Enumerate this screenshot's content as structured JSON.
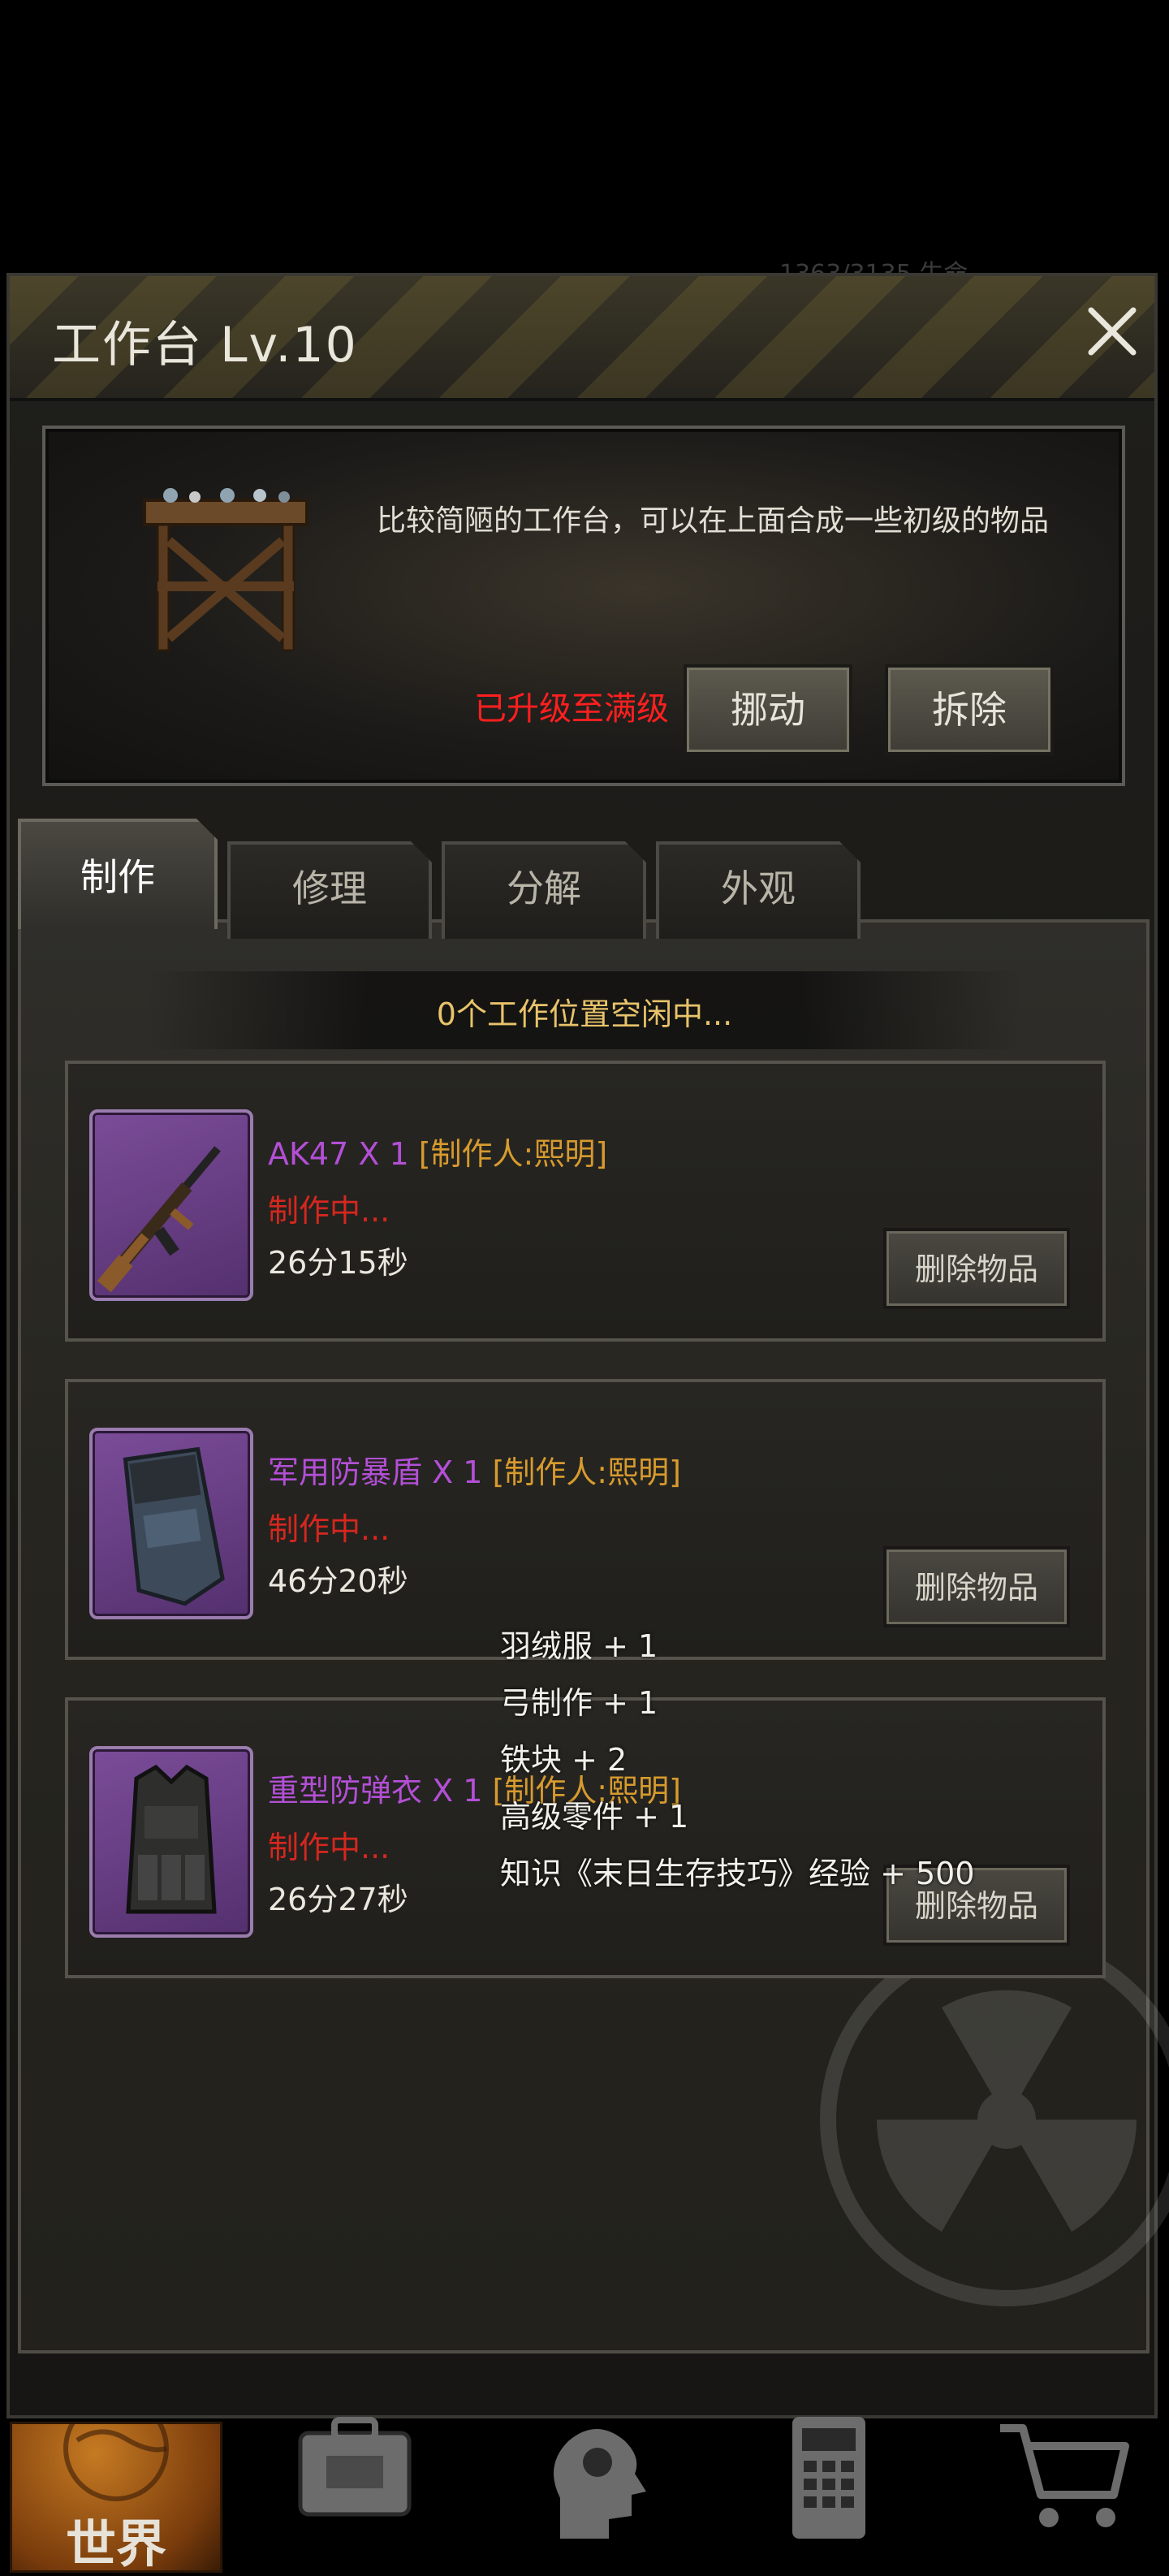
{
  "background_status": {
    "text": "1363/3135      生命"
  },
  "header": {
    "title": "工作台 Lv.10",
    "close_icon": "close-icon"
  },
  "info": {
    "description": "比较简陋的工作台，可以在上面合成一些初级的物品",
    "maxed_text": "已升级至满级",
    "move_label": "挪动",
    "dismantle_label": "拆除"
  },
  "tabs": [
    {
      "label": "制作",
      "active": true
    },
    {
      "label": "修理",
      "active": false
    },
    {
      "label": "分解",
      "active": false
    },
    {
      "label": "外观",
      "active": false
    }
  ],
  "status_text": "0个工作位置空闲中...",
  "crafts": [
    {
      "name": "AK47 X 1",
      "maker": "[制作人:熙明]",
      "state": "制作中...",
      "time": "26分15秒",
      "delete_label": "删除物品",
      "icon": "rifle-icon"
    },
    {
      "name": "军用防暴盾 X 1",
      "maker": "[制作人:熙明]",
      "state": "制作中...",
      "time": "46分20秒",
      "delete_label": "删除物品",
      "icon": "riot-shield-icon"
    },
    {
      "name": "重型防弹衣 X 1",
      "maker": "[制作人:熙明]",
      "state": "制作中...",
      "time": "26分27秒",
      "delete_label": "删除物品",
      "icon": "body-armor-icon"
    }
  ],
  "rewards": [
    "羽绒服 + 1",
    "弓制作 + 1",
    "铁块 + 2",
    "高级零件 + 1",
    "知识《末日生存技巧》经验 + 500"
  ],
  "bottom_nav": {
    "world_label": "世界",
    "icons": [
      "backpack-icon",
      "character-head-icon",
      "phone-icon",
      "shopping-cart-icon"
    ]
  },
  "colors": {
    "maxed": "#ff1f1f",
    "item_name": "#b34fd6",
    "maker": "#d79a2e",
    "state": "#d5271f",
    "status": "#e8c36a"
  }
}
